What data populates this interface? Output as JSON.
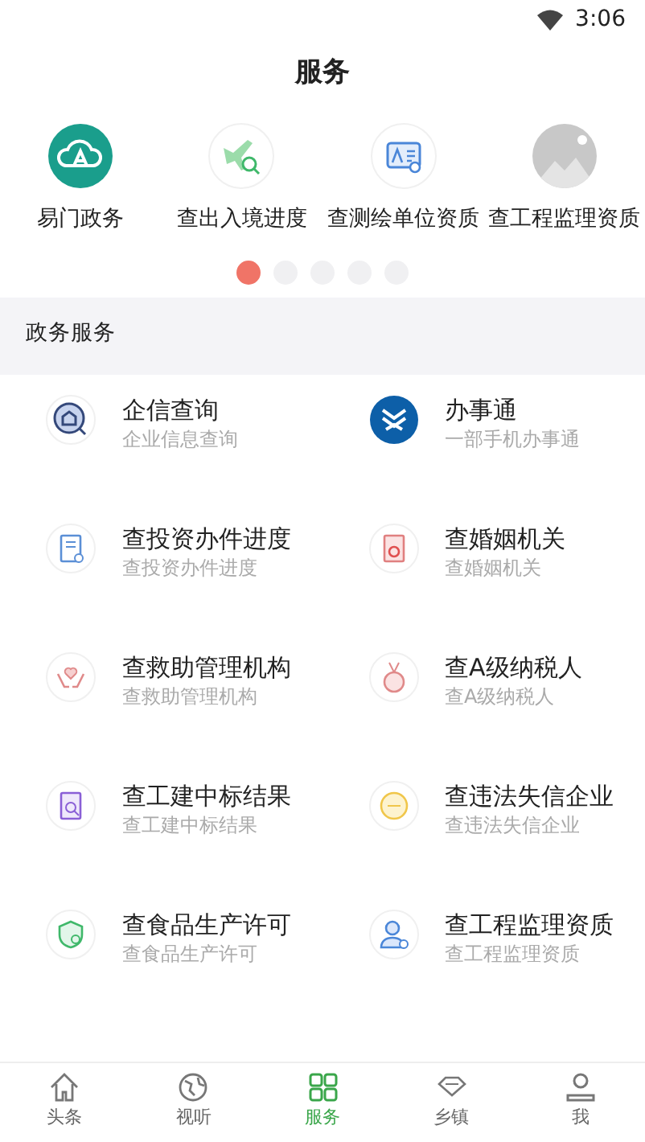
{
  "status_bar": {
    "time": "3:06"
  },
  "title": "服务",
  "shortcuts": [
    {
      "label": "易门政务"
    },
    {
      "label": "查出入境进度"
    },
    {
      "label": "查测绘单位资质"
    },
    {
      "label": "查工程监理资质"
    }
  ],
  "pager": [
    {
      "selected": true
    },
    {
      "selected": false
    },
    {
      "selected": false
    },
    {
      "selected": false
    },
    {
      "selected": false
    }
  ],
  "section": {
    "title": "政务服务"
  },
  "services": [
    {
      "name": "企信查询",
      "subtitle": "企业信息查询"
    },
    {
      "name": "办事通",
      "subtitle": "一部手机办事通"
    },
    {
      "name": "查投资办件进度",
      "subtitle": "查投资办件进度"
    },
    {
      "name": "查婚姻机关",
      "subtitle": "查婚姻机关"
    },
    {
      "name": "查救助管理机构",
      "subtitle": "查救助管理机构"
    },
    {
      "name": "查A级纳税人",
      "subtitle": "查A级纳税人"
    },
    {
      "name": "查工建中标结果",
      "subtitle": "查工建中标结果"
    },
    {
      "name": "查违法失信企业",
      "subtitle": "查违法失信企业"
    },
    {
      "name": "查食品生产许可",
      "subtitle": "查食品生产许可"
    },
    {
      "name": "查工程监理资质",
      "subtitle": "查工程监理资质"
    }
  ],
  "tab_bar": [
    {
      "label": "头条",
      "selected": false
    },
    {
      "label": "视听",
      "selected": false
    },
    {
      "label": "服务",
      "selected": true
    },
    {
      "label": "乡镇",
      "selected": false
    },
    {
      "label": "我",
      "selected": false
    }
  ]
}
